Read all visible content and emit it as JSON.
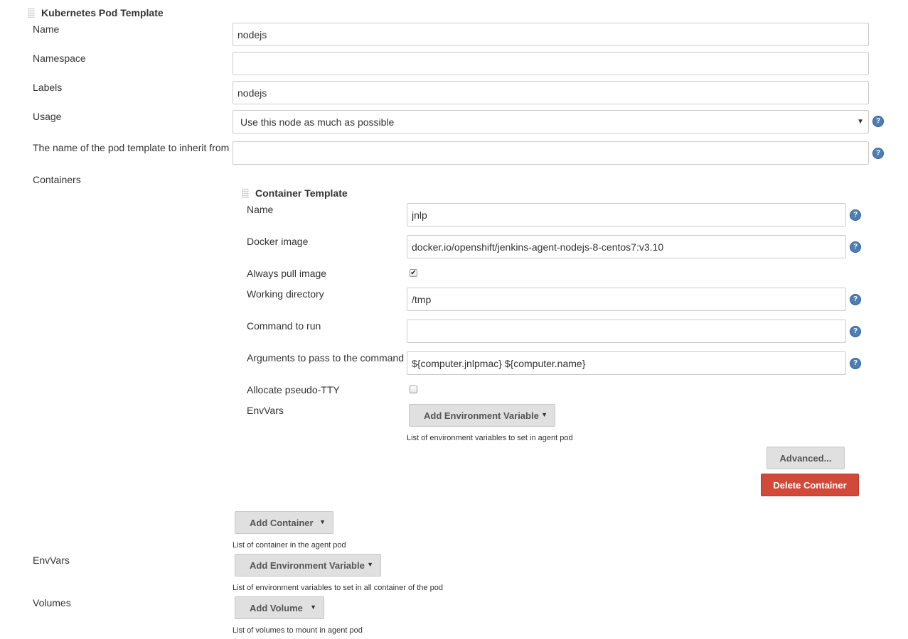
{
  "pod_template": {
    "title": "Kubernetes Pod Template",
    "name": {
      "label": "Name",
      "value": "nodejs"
    },
    "namespace": {
      "label": "Namespace",
      "value": ""
    },
    "labels": {
      "label": "Labels",
      "value": "nodejs"
    },
    "usage": {
      "label": "Usage",
      "selected": "Use this node as much as possible"
    },
    "inherit_from": {
      "label": "The name of the pod template to inherit from",
      "value": ""
    },
    "containers_label": "Containers",
    "add_container_label": "Add Container",
    "containers_hint": "List of container in the agent pod",
    "envvars": {
      "label": "EnvVars",
      "button": "Add Environment Variable",
      "hint": "List of environment variables to set in all container of the pod"
    },
    "volumes": {
      "label": "Volumes",
      "button": "Add Volume",
      "hint": "List of volumes to mount in agent pod"
    }
  },
  "container_template": {
    "title": "Container Template",
    "name": {
      "label": "Name",
      "value": "jnlp"
    },
    "docker_image": {
      "label": "Docker image",
      "value": "docker.io/openshift/jenkins-agent-nodejs-8-centos7:v3.10"
    },
    "always_pull": {
      "label": "Always pull image",
      "checked": true
    },
    "working_dir": {
      "label": "Working directory",
      "value": "/tmp"
    },
    "command": {
      "label": "Command to run",
      "value": ""
    },
    "args": {
      "label": "Arguments to pass to the command",
      "value": "${computer.jnlpmac} ${computer.name}"
    },
    "tty": {
      "label": "Allocate pseudo-TTY",
      "checked": false
    },
    "envvars": {
      "label": "EnvVars",
      "button": "Add Environment Variable",
      "hint": "List of environment variables to set in agent pod"
    },
    "advanced_label": "Advanced...",
    "delete_label": "Delete Container"
  },
  "icons": {
    "help": "help-question-icon",
    "dropdown": "caret-down-icon",
    "drag": "drag-handle-icon"
  },
  "colors": {
    "help_icon": "#4d7fb5",
    "delete_button": "#d24939",
    "button_gray": "#e0e0e0"
  }
}
